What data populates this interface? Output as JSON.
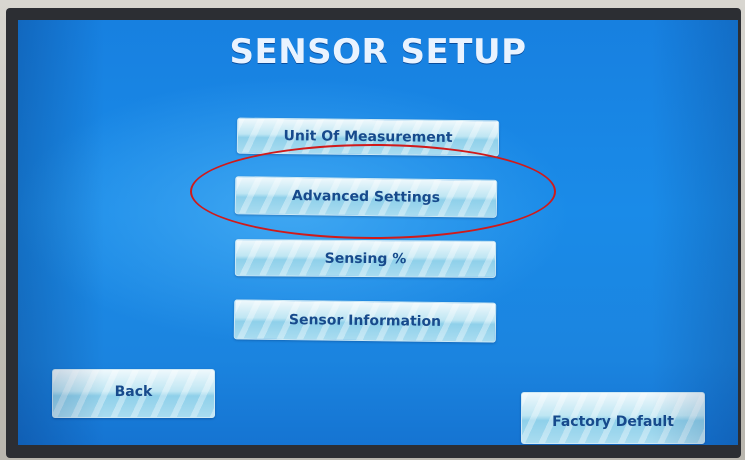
{
  "screen": {
    "title": "SENSOR SETUP"
  },
  "menu": {
    "items": [
      {
        "label": "Unit Of Measurement"
      },
      {
        "label": "Advanced Settings"
      },
      {
        "label": "Sensing %"
      },
      {
        "label": "Sensor Information"
      }
    ]
  },
  "footer": {
    "back_label": "Back",
    "factory_default_label": "Factory Default"
  },
  "colors": {
    "screen_blue": "#1a8be8",
    "button_text": "#174a8c",
    "highlight_ellipse": "#d01a1a"
  }
}
